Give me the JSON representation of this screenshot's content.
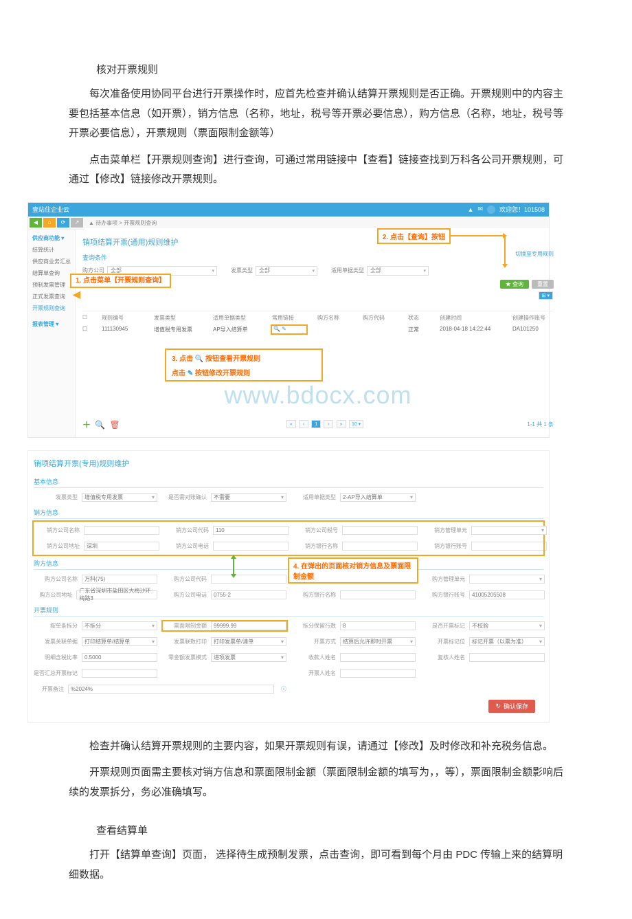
{
  "doc": {
    "h1": "核对开票规则",
    "p1": "每次准备使用协同平台进行开票操作时，应首先检查并确认结算开票规则是否正确。开票规则中的内容主要包括基本信息（如开票），销方信息（名称，地址，税号等开票必要信息），购方信息（名称，地址，税号等开票必要信息），开票规则（票面限制金额等）",
    "p2": "点击菜单栏【开票规则查询】进行查询，可通过常用链接中【查看】链接查找到万科各公司开票规则，可通过【修改】链接修改开票规则。",
    "p3": "检查并确认结算开票规则的主要内容，如果开票规则有误，请通过【修改】及时修改和补充税务信息。",
    "p4": "开票规则页面需主要核对销方信息和票面限制金额（票面限制金额的填写为，，等），票面限制金额影响后续的发票拆分，务必准确填写。",
    "h2": "查看结算单",
    "p5": "打开【结算单查询】页面， 选择待生成预制发票，点击查询，即可看到每个月由 PDC 传输上来的结算明细数据。"
  },
  "shot1": {
    "brand": "壹站住企业云",
    "user": "欢迎您！101508",
    "crumb_icon": "▲",
    "crumb": "待办事项  >  开票规则查询",
    "sidebar": {
      "head": "供应商功能",
      "items": [
        "结算统计",
        "供应商业务汇总",
        "结算单查询",
        "预制发票管理",
        "正式发票查询",
        "开票规则查询"
      ],
      "head2": "报表管理"
    },
    "page_title": "销项结算开票(通用)规则维护",
    "sub_title": "查询条件",
    "filters": {
      "f1_label": "购方公司",
      "f1_value": "全部",
      "f2_label": "发票类型",
      "f2_value": "全部",
      "f3_label": "适用单据类型",
      "f3_value": "全部"
    },
    "right_link": "切换至专用规则",
    "query_btn": "查询",
    "reset_btn": "重置",
    "callout1": "1. 点击菜单【开票规则查询】",
    "callout2": "2. 点击【查询】按钮",
    "callout3a": "3. 点击",
    "callout3b": "按钮查看开票规则",
    "callout3c": "点击",
    "callout3d": "按钮修改开票规则",
    "table": {
      "headers": [
        "规则编号",
        "发票类型",
        "适用单据类型",
        "常用链接",
        "购方名称",
        "购方代码",
        "状态",
        "创建时间",
        "创建操作账号"
      ],
      "row": {
        "id": "111130945",
        "type": "增值税专用发票",
        "doc": "AP导入结算单",
        "status": "正常",
        "time": "2018-04-18 14:22:44",
        "acct": "DA101250"
      }
    },
    "pager": "1-1  共 1 条",
    "pager_nums": "1",
    "watermark": "www.bdocx.com",
    "plus_label": "新建"
  },
  "shot2": {
    "title": "销项结算开票(专用)规则维护",
    "sec_basic": "基本信息",
    "basic": {
      "f1_l": "发票类型",
      "f1_v": "增值税专用发票",
      "f2_l": "是否需对账确认",
      "f2_v": "不需要",
      "f3_l": "适用单据类型",
      "f3_v": "2-AP导入结算单"
    },
    "sec_seller": "销方信息",
    "seller": {
      "f1_l": "销方公司名称",
      "f1_v": "",
      "f2_l": "销方公司代码",
      "f2_v": "110",
      "f3_l": "销方公司税号",
      "f3_v": "",
      "f4_l": "销方管理单元",
      "f4_v": "",
      "f5_l": "销方公司地址",
      "f5_v": "深圳",
      "f6_l": "销方公司电话",
      "f6_v": "",
      "f7_l": "销方银行名称",
      "f7_v": "",
      "f8_l": "销方银行账号",
      "f8_v": ""
    },
    "sec_buyer": "购方信息",
    "buyer": {
      "f1_l": "购方公司名称",
      "f1_v": "万科(75)",
      "f2_l": "购方公司代码",
      "f2_v": "",
      "f3_l": "购方公司税号",
      "f3_v": "",
      "f4_l": "购方管理单元",
      "f4_v": "",
      "f5_l": "购方公司地址",
      "f5_v": "广东省深圳市盐田区大梅沙环梅路3",
      "f6_l": "购方公司电话",
      "f6_v": "0755-2",
      "f7_l": "购方银行名称",
      "f7_v": "",
      "f8_l": "购方银行账号",
      "f8_v": "41005205508"
    },
    "sec_rule": "开票规则",
    "rule": {
      "f1_l": "按单条拆分",
      "f1_v": "不拆分",
      "f2_l": "票面限制金额",
      "f2_v": "99999.99",
      "f3_l": "拆分保留行数",
      "f3_v": "8",
      "f4_l": "是否开票标记",
      "f4_v": "不校验",
      "f5_l": "发票关联单据",
      "f5_v": "打印结算单/结算单",
      "f6_l": "发票联数打印",
      "f6_v": "打印发票单/清单",
      "f7_l": "开票方式",
      "f7_v": "结算后允许即时开票",
      "f8_l": "开票标记位",
      "f8_v": "标记开票（以票为准）",
      "f9_l": "明细含税比率",
      "f9_v": "0.5000",
      "f10_l": "零金额发票模式",
      "f10_v": "进项发票",
      "f11_l": "收款人姓名",
      "f11_v": "",
      "f12_l": "复核人姓名",
      "f12_v": "",
      "f13_l": "是否汇总开票标记",
      "f13_v": "",
      "f14_l": "",
      "f14_v": "",
      "f15_l": "开票人姓名",
      "f15_v": "",
      "f16_l": "开票备注",
      "f16_v": "%2024%"
    },
    "callout4": "4. 在弹出的页面核对销方信息及票面限制金额",
    "save_btn": "确认保存"
  }
}
